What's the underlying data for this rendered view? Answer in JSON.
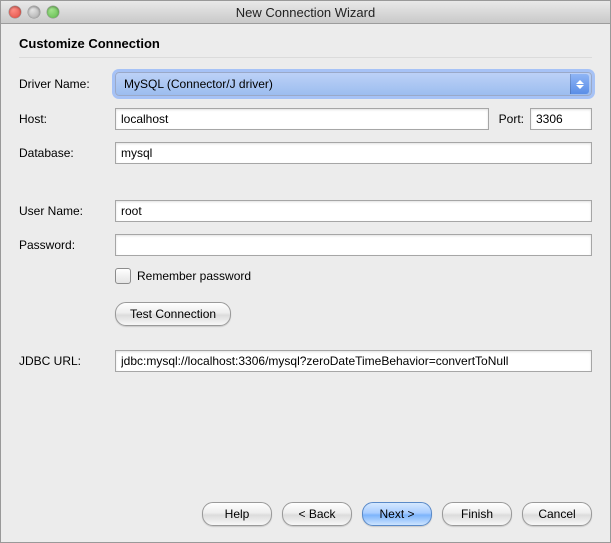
{
  "window": {
    "title": "New Connection Wizard"
  },
  "section": {
    "title": "Customize Connection"
  },
  "labels": {
    "driver_name": "Driver Name:",
    "host": "Host:",
    "port": "Port:",
    "database": "Database:",
    "user_name": "User Name:",
    "password": "Password:",
    "jdbc_url": "JDBC URL:"
  },
  "values": {
    "driver_name": "MySQL (Connector/J driver)",
    "host": "localhost",
    "port": "3306",
    "database": "mysql",
    "user_name": "root",
    "password": "",
    "jdbc_url": "jdbc:mysql://localhost:3306/mysql?zeroDateTimeBehavior=convertToNull"
  },
  "checkbox": {
    "remember_password": "Remember password"
  },
  "buttons": {
    "test_connection": "Test Connection",
    "help": "Help",
    "back": "< Back",
    "next": "Next >",
    "finish": "Finish",
    "cancel": "Cancel"
  }
}
